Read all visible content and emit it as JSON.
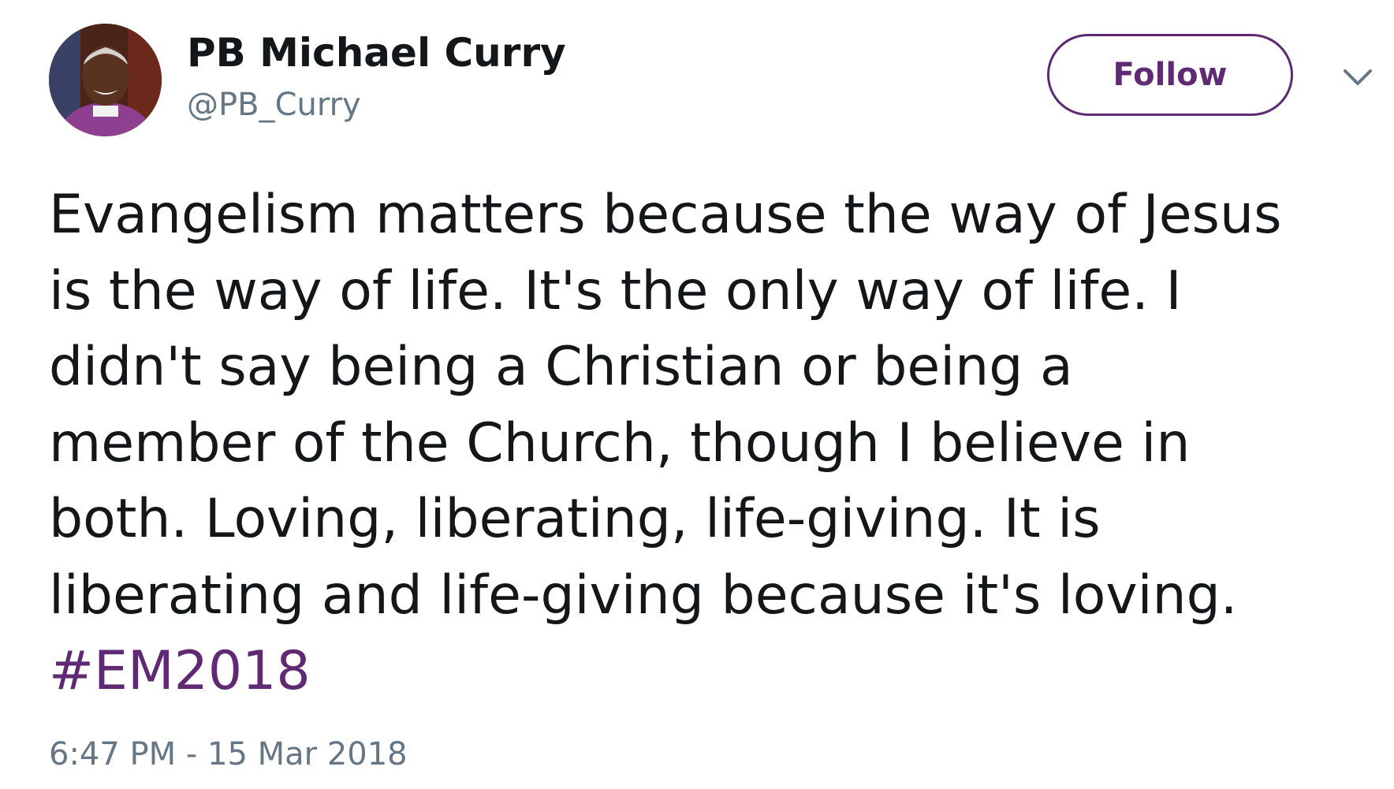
{
  "user": {
    "display_name": "PB Michael Curry",
    "handle": "@PB_Curry"
  },
  "actions": {
    "follow_label": "Follow",
    "menu_icon": "chevron-down-icon"
  },
  "tweet": {
    "lines": [
      "Evangelism matters because the way of Jesus",
      "is the way of life. It's the only way of life. I",
      "didn't say being a Christian or being a",
      "member of the Church, though I believe in",
      "both. Loving, liberating, life-giving. It is",
      "liberating and life-giving because it's loving."
    ],
    "hashtag": "#EM2018",
    "timestamp": "6:47 PM - 15 Mar 2018"
  },
  "colors": {
    "accent": "#5f2a73",
    "text": "#14171a",
    "muted": "#657786"
  }
}
